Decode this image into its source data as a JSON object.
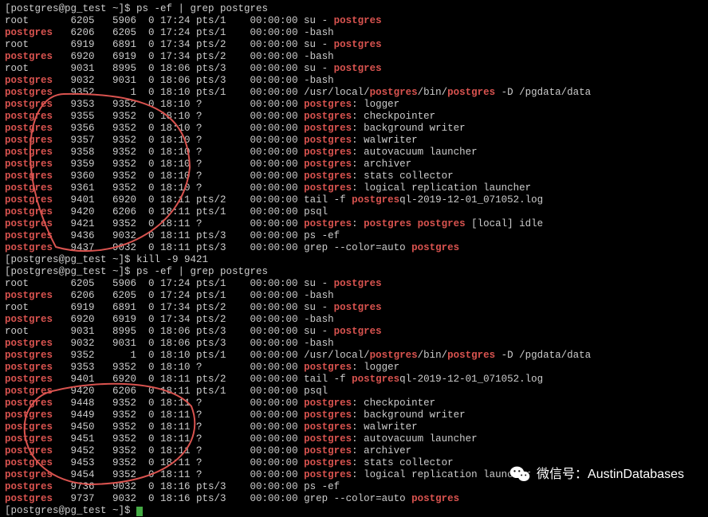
{
  "prompt1": "[postgres@pg_test ~]$ ",
  "cmd_ps_grep": "ps -ef | grep postgres",
  "cmd_kill": "kill -9 9421",
  "watermark": "微信号：AustinDatabases",
  "colors": {
    "highlight": "#d9534f",
    "fg": "#cccccc",
    "bg": "#000000"
  },
  "ps_before": [
    {
      "user": "root",
      "pid": "6205",
      "ppid": "5906",
      "c": "0",
      "stime": "17:24",
      "tty": "pts/1",
      "time": "00:00:00",
      "cmd": "su - postgres",
      "hl": [
        "postgres"
      ]
    },
    {
      "user": "postgres",
      "pid": "6206",
      "ppid": "6205",
      "c": "0",
      "stime": "17:24",
      "tty": "pts/1",
      "time": "00:00:00",
      "cmd": "-bash",
      "hl": []
    },
    {
      "user": "root",
      "pid": "6919",
      "ppid": "6891",
      "c": "0",
      "stime": "17:34",
      "tty": "pts/2",
      "time": "00:00:00",
      "cmd": "su - postgres",
      "hl": [
        "postgres"
      ]
    },
    {
      "user": "postgres",
      "pid": "6920",
      "ppid": "6919",
      "c": "0",
      "stime": "17:34",
      "tty": "pts/2",
      "time": "00:00:00",
      "cmd": "-bash",
      "hl": []
    },
    {
      "user": "root",
      "pid": "9031",
      "ppid": "8995",
      "c": "0",
      "stime": "18:06",
      "tty": "pts/3",
      "time": "00:00:00",
      "cmd": "su - postgres",
      "hl": [
        "postgres"
      ]
    },
    {
      "user": "postgres",
      "pid": "9032",
      "ppid": "9031",
      "c": "0",
      "stime": "18:06",
      "tty": "pts/3",
      "time": "00:00:00",
      "cmd": "-bash",
      "hl": []
    },
    {
      "user": "postgres",
      "pid": "9352",
      "ppid": "1",
      "c": "0",
      "stime": "18:10",
      "tty": "pts/1",
      "time": "00:00:00",
      "cmd": "/usr/local/postgres/bin/postgres -D /pgdata/data",
      "hl": [
        "postgres",
        "postgres"
      ]
    },
    {
      "user": "postgres",
      "pid": "9353",
      "ppid": "9352",
      "c": "0",
      "stime": "18:10",
      "tty": "?",
      "time": "00:00:00",
      "cmd": "postgres: logger",
      "hl": [
        "postgres"
      ]
    },
    {
      "user": "postgres",
      "pid": "9355",
      "ppid": "9352",
      "c": "0",
      "stime": "18:10",
      "tty": "?",
      "time": "00:00:00",
      "cmd": "postgres: checkpointer",
      "hl": [
        "postgres"
      ]
    },
    {
      "user": "postgres",
      "pid": "9356",
      "ppid": "9352",
      "c": "0",
      "stime": "18:10",
      "tty": "?",
      "time": "00:00:00",
      "cmd": "postgres: background writer",
      "hl": [
        "postgres"
      ]
    },
    {
      "user": "postgres",
      "pid": "9357",
      "ppid": "9352",
      "c": "0",
      "stime": "18:10",
      "tty": "?",
      "time": "00:00:00",
      "cmd": "postgres: walwriter",
      "hl": [
        "postgres"
      ]
    },
    {
      "user": "postgres",
      "pid": "9358",
      "ppid": "9352",
      "c": "0",
      "stime": "18:10",
      "tty": "?",
      "time": "00:00:00",
      "cmd": "postgres: autovacuum launcher",
      "hl": [
        "postgres"
      ]
    },
    {
      "user": "postgres",
      "pid": "9359",
      "ppid": "9352",
      "c": "0",
      "stime": "18:10",
      "tty": "?",
      "time": "00:00:00",
      "cmd": "postgres: archiver",
      "hl": [
        "postgres"
      ]
    },
    {
      "user": "postgres",
      "pid": "9360",
      "ppid": "9352",
      "c": "0",
      "stime": "18:10",
      "tty": "?",
      "time": "00:00:00",
      "cmd": "postgres: stats collector",
      "hl": [
        "postgres"
      ]
    },
    {
      "user": "postgres",
      "pid": "9361",
      "ppid": "9352",
      "c": "0",
      "stime": "18:10",
      "tty": "?",
      "time": "00:00:00",
      "cmd": "postgres: logical replication launcher",
      "hl": [
        "postgres"
      ]
    },
    {
      "user": "postgres",
      "pid": "9401",
      "ppid": "6920",
      "c": "0",
      "stime": "18:11",
      "tty": "pts/2",
      "time": "00:00:00",
      "cmd": "tail -f postgresql-2019-12-01_071052.log",
      "hl": [
        "postgres"
      ]
    },
    {
      "user": "postgres",
      "pid": "9420",
      "ppid": "6206",
      "c": "0",
      "stime": "18:11",
      "tty": "pts/1",
      "time": "00:00:00",
      "cmd": "psql",
      "hl": []
    },
    {
      "user": "postgres",
      "pid": "9421",
      "ppid": "9352",
      "c": "0",
      "stime": "18:11",
      "tty": "?",
      "time": "00:00:00",
      "cmd": "postgres: postgres postgres [local] idle",
      "hl": [
        "postgres",
        "postgres",
        "postgres"
      ]
    },
    {
      "user": "postgres",
      "pid": "9436",
      "ppid": "9032",
      "c": "0",
      "stime": "18:11",
      "tty": "pts/3",
      "time": "00:00:00",
      "cmd": "ps -ef",
      "hl": []
    },
    {
      "user": "postgres",
      "pid": "9437",
      "ppid": "9032",
      "c": "0",
      "stime": "18:11",
      "tty": "pts/3",
      "time": "00:00:00",
      "cmd": "grep --color=auto postgres",
      "hl": [
        "postgres"
      ]
    }
  ],
  "ps_after": [
    {
      "user": "root",
      "pid": "6205",
      "ppid": "5906",
      "c": "0",
      "stime": "17:24",
      "tty": "pts/1",
      "time": "00:00:00",
      "cmd": "su - postgres",
      "hl": [
        "postgres"
      ]
    },
    {
      "user": "postgres",
      "pid": "6206",
      "ppid": "6205",
      "c": "0",
      "stime": "17:24",
      "tty": "pts/1",
      "time": "00:00:00",
      "cmd": "-bash",
      "hl": []
    },
    {
      "user": "root",
      "pid": "6919",
      "ppid": "6891",
      "c": "0",
      "stime": "17:34",
      "tty": "pts/2",
      "time": "00:00:00",
      "cmd": "su - postgres",
      "hl": [
        "postgres"
      ]
    },
    {
      "user": "postgres",
      "pid": "6920",
      "ppid": "6919",
      "c": "0",
      "stime": "17:34",
      "tty": "pts/2",
      "time": "00:00:00",
      "cmd": "-bash",
      "hl": []
    },
    {
      "user": "root",
      "pid": "9031",
      "ppid": "8995",
      "c": "0",
      "stime": "18:06",
      "tty": "pts/3",
      "time": "00:00:00",
      "cmd": "su - postgres",
      "hl": [
        "postgres"
      ]
    },
    {
      "user": "postgres",
      "pid": "9032",
      "ppid": "9031",
      "c": "0",
      "stime": "18:06",
      "tty": "pts/3",
      "time": "00:00:00",
      "cmd": "-bash",
      "hl": []
    },
    {
      "user": "postgres",
      "pid": "9352",
      "ppid": "1",
      "c": "0",
      "stime": "18:10",
      "tty": "pts/1",
      "time": "00:00:00",
      "cmd": "/usr/local/postgres/bin/postgres -D /pgdata/data",
      "hl": [
        "postgres",
        "postgres"
      ]
    },
    {
      "user": "postgres",
      "pid": "9353",
      "ppid": "9352",
      "c": "0",
      "stime": "18:10",
      "tty": "?",
      "time": "00:00:00",
      "cmd": "postgres: logger",
      "hl": [
        "postgres"
      ]
    },
    {
      "user": "postgres",
      "pid": "9401",
      "ppid": "6920",
      "c": "0",
      "stime": "18:11",
      "tty": "pts/2",
      "time": "00:00:00",
      "cmd": "tail -f postgresql-2019-12-01_071052.log",
      "hl": [
        "postgres"
      ]
    },
    {
      "user": "postgres",
      "pid": "9420",
      "ppid": "6206",
      "c": "0",
      "stime": "18:11",
      "tty": "pts/1",
      "time": "00:00:00",
      "cmd": "psql",
      "hl": []
    },
    {
      "user": "postgres",
      "pid": "9448",
      "ppid": "9352",
      "c": "0",
      "stime": "18:11",
      "tty": "?",
      "time": "00:00:00",
      "cmd": "postgres: checkpointer",
      "hl": [
        "postgres"
      ]
    },
    {
      "user": "postgres",
      "pid": "9449",
      "ppid": "9352",
      "c": "0",
      "stime": "18:11",
      "tty": "?",
      "time": "00:00:00",
      "cmd": "postgres: background writer",
      "hl": [
        "postgres"
      ]
    },
    {
      "user": "postgres",
      "pid": "9450",
      "ppid": "9352",
      "c": "0",
      "stime": "18:11",
      "tty": "?",
      "time": "00:00:00",
      "cmd": "postgres: walwriter",
      "hl": [
        "postgres"
      ]
    },
    {
      "user": "postgres",
      "pid": "9451",
      "ppid": "9352",
      "c": "0",
      "stime": "18:11",
      "tty": "?",
      "time": "00:00:00",
      "cmd": "postgres: autovacuum launcher",
      "hl": [
        "postgres"
      ]
    },
    {
      "user": "postgres",
      "pid": "9452",
      "ppid": "9352",
      "c": "0",
      "stime": "18:11",
      "tty": "?",
      "time": "00:00:00",
      "cmd": "postgres: archiver",
      "hl": [
        "postgres"
      ]
    },
    {
      "user": "postgres",
      "pid": "9453",
      "ppid": "9352",
      "c": "0",
      "stime": "18:11",
      "tty": "?",
      "time": "00:00:00",
      "cmd": "postgres: stats collector",
      "hl": [
        "postgres"
      ]
    },
    {
      "user": "postgres",
      "pid": "9454",
      "ppid": "9352",
      "c": "0",
      "stime": "18:11",
      "tty": "?",
      "time": "00:00:00",
      "cmd": "postgres: logical replication launcher",
      "hl": [
        "postgres"
      ]
    },
    {
      "user": "postgres",
      "pid": "9736",
      "ppid": "9032",
      "c": "0",
      "stime": "18:16",
      "tty": "pts/3",
      "time": "00:00:00",
      "cmd": "ps -ef",
      "hl": []
    },
    {
      "user": "postgres",
      "pid": "9737",
      "ppid": "9032",
      "c": "0",
      "stime": "18:16",
      "tty": "pts/3",
      "time": "00:00:00",
      "cmd": "grep --color=auto postgres",
      "hl": [
        "postgres"
      ]
    }
  ]
}
